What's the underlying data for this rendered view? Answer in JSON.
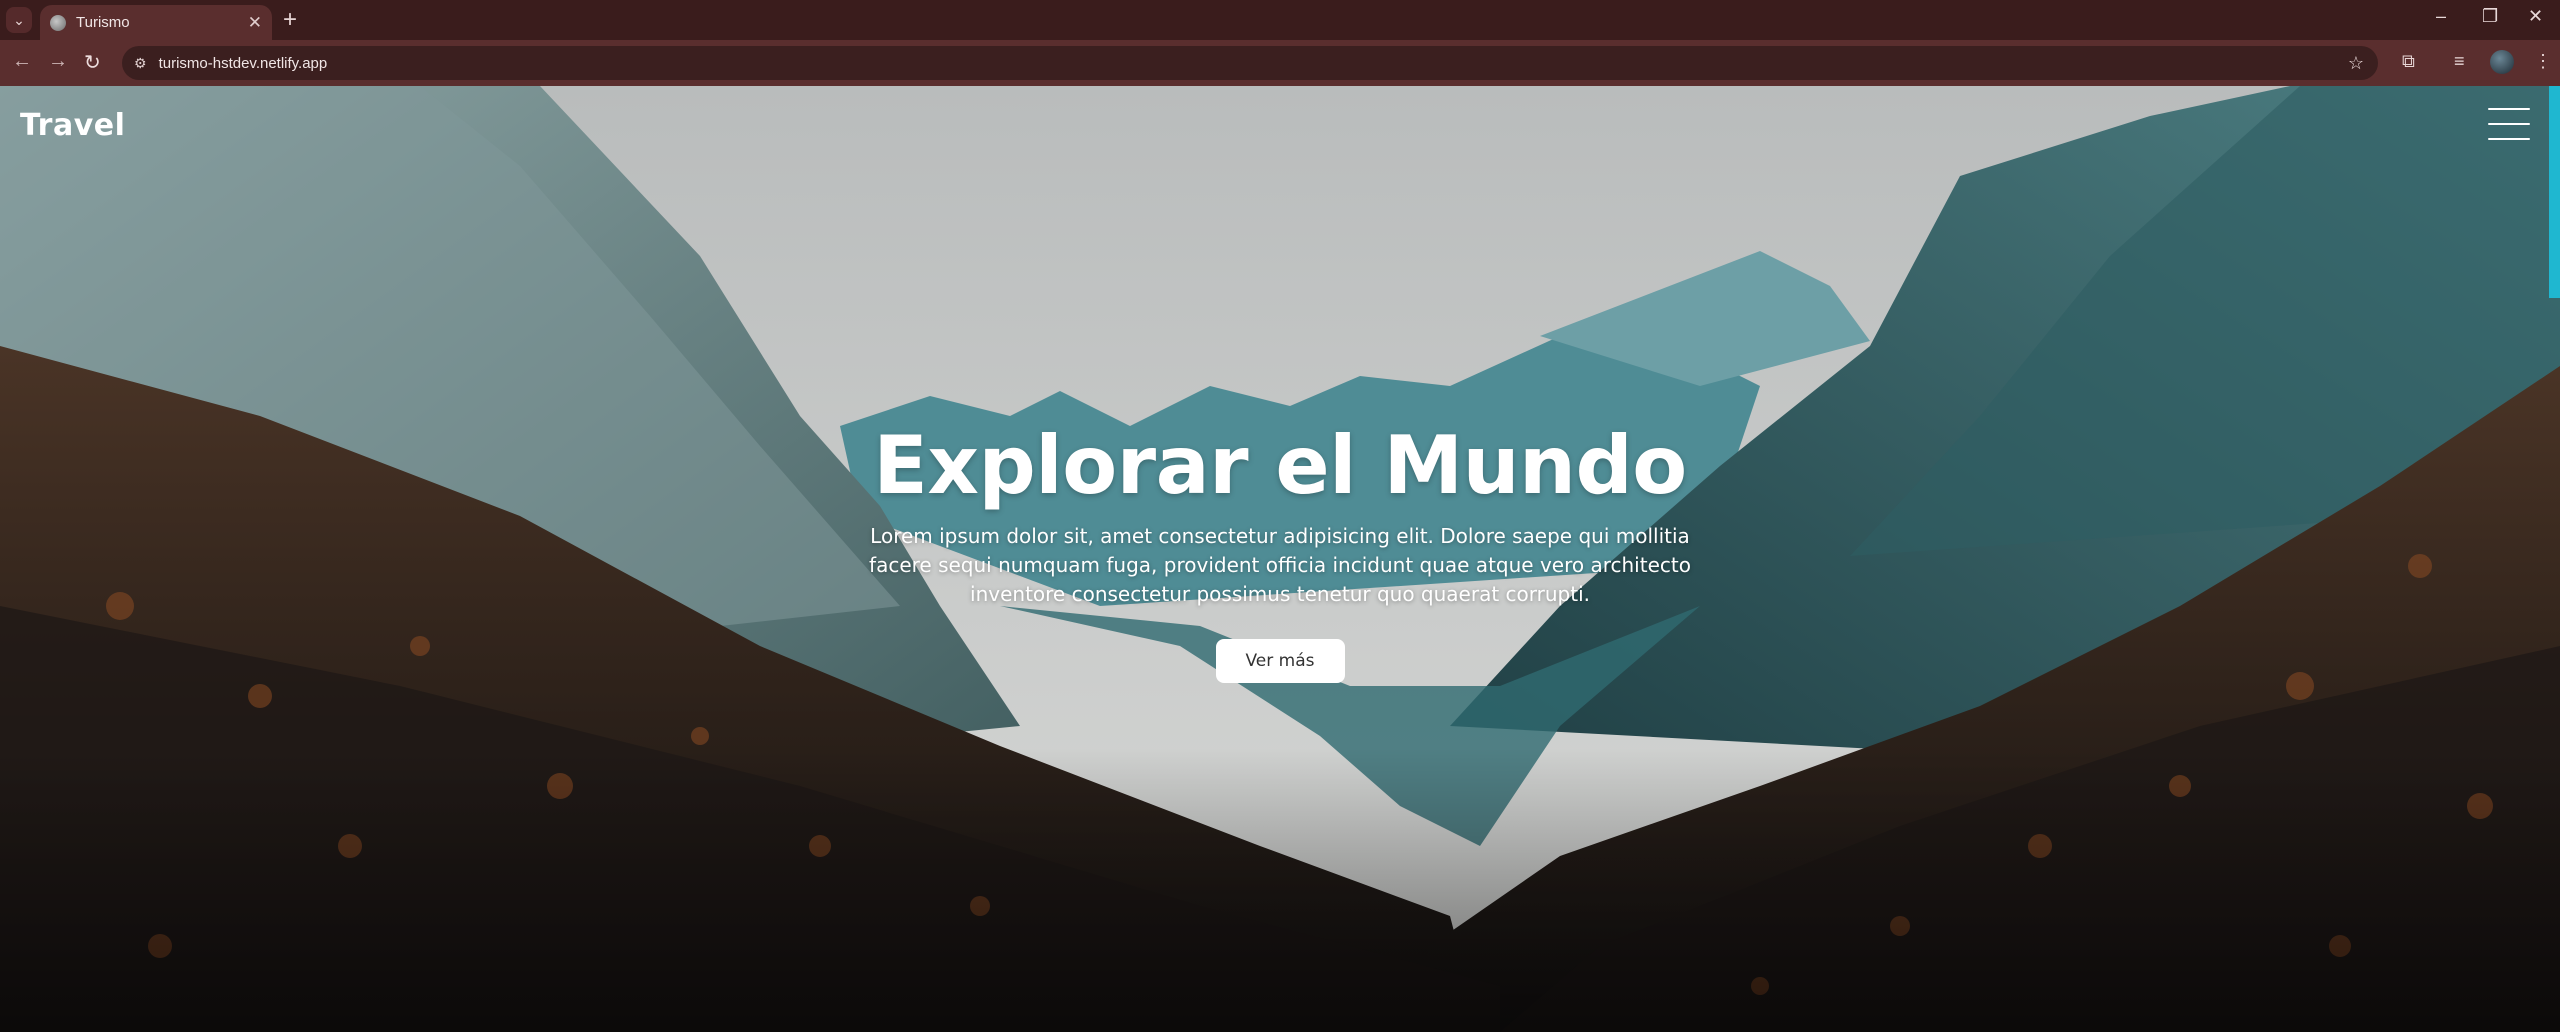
{
  "browser": {
    "tab_title": "Turismo",
    "tab_close": "✕",
    "new_tab": "+",
    "url": "turismo-hstdev.netlify.app",
    "icons": [
      "tab-search-icon",
      "favicon-icon",
      "back-icon",
      "forward-icon",
      "reload-icon",
      "site-info-icon",
      "bookmark-star-icon",
      "extensions-icon",
      "media-icon",
      "profile-avatar-icon",
      "kebab-menu-icon",
      "minimize-icon",
      "restore-icon",
      "close-window-icon"
    ]
  },
  "site": {
    "brand": "Travel",
    "hero": {
      "title": "Explorar el Mundo",
      "text": "Lorem ipsum dolor sit, amet consectetur adipisicing elit. Dolore saepe qui mollitia facere sequi numquam fuga, provident officia incidunt quae atque vero architecto inventore consectetur possimus tenetur quo quaerat corrupti.",
      "button": "Ver más"
    },
    "colors": {
      "browser_frame": "#3a1c1c",
      "toolbar": "#5a2e2e",
      "scroll_thumb": "#1fb7d0",
      "button_bg": "#ffffff"
    }
  }
}
